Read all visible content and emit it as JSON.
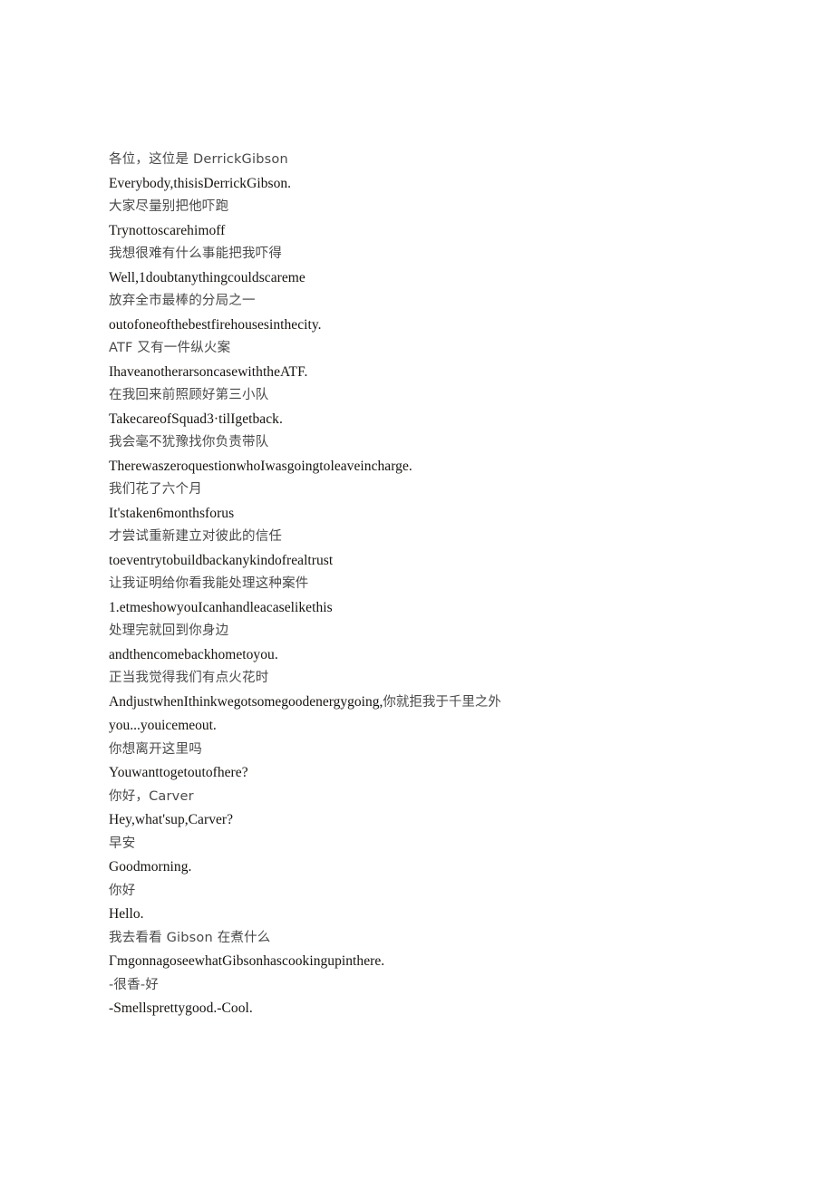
{
  "page": {
    "background_color": "#ffffff",
    "text_color_chinese": "#4a4a4a",
    "text_color_english": "#16120f"
  },
  "transcript": {
    "lines": [
      {
        "lang": "zh",
        "text": "各位，这位是 DerrickGibson"
      },
      {
        "lang": "en",
        "text": "Everybody,thisisDerrickGibson."
      },
      {
        "lang": "zh",
        "text": "大家尽量别把他吓跑"
      },
      {
        "lang": "en",
        "text": "Trynottoscarehimoff"
      },
      {
        "lang": "zh",
        "text": "我想很难有什么事能把我吓得"
      },
      {
        "lang": "en",
        "text": "Well,1doubtanythingcouldscareme"
      },
      {
        "lang": "zh",
        "text": "放弃全市最棒的分局之一"
      },
      {
        "lang": "en",
        "text": "outofoneofthebestfirehousesinthecity."
      },
      {
        "lang": "zh",
        "text": "ATF 又有一件纵火案"
      },
      {
        "lang": "en",
        "text": "IhaveanotherarsoncasewiththeATF."
      },
      {
        "lang": "zh",
        "text": "在我回来前照顾好第三小队"
      },
      {
        "lang": "en",
        "text": "TakecareofSquad3·tilIgetback."
      },
      {
        "lang": "zh",
        "text": "我会毫不犹豫找你负责带队"
      },
      {
        "lang": "en",
        "text": "TherewaszeroquestionwhoIwasgoingtoleaveincharge."
      },
      {
        "lang": "zh",
        "text": "我们花了六个月"
      },
      {
        "lang": "en",
        "text": "It'staken6monthsforus"
      },
      {
        "lang": "zh",
        "text": "才尝试重新建立对彼此的信任"
      },
      {
        "lang": "en",
        "text": "toeventrytobuildbackanykindofrealtrust"
      },
      {
        "lang": "zh",
        "text": "让我证明给你看我能处理这种案件"
      },
      {
        "lang": "en",
        "text": "1.etmeshowyouIcanhandleacaselikethis"
      },
      {
        "lang": "zh",
        "text": "处理完就回到你身边"
      },
      {
        "lang": "en",
        "text": "andthencomebackhometoyou."
      },
      {
        "lang": "zh",
        "text": "正当我觉得我们有点火花时"
      },
      {
        "lang": "mixed",
        "text_en_a": "AndjustwhenIthinkwegotsomegoodenergygoing,",
        "text_zh": "你就拒我于千里之外",
        "text_en_b": "you...youicemeout."
      },
      {
        "lang": "zh",
        "text": "你想离开这里吗"
      },
      {
        "lang": "en",
        "text": "Youwanttogetoutofhere?"
      },
      {
        "lang": "zh",
        "text": "你好，Carver"
      },
      {
        "lang": "en",
        "text": "Hey,what'sup,Carver?"
      },
      {
        "lang": "zh",
        "text": "早安"
      },
      {
        "lang": "en",
        "text": "Goodmorning."
      },
      {
        "lang": "zh",
        "text": "你好"
      },
      {
        "lang": "en",
        "text": "Hello."
      },
      {
        "lang": "zh",
        "text": "我去看看 Gibson 在煮什么"
      },
      {
        "lang": "en",
        "text": "ΓmgonnagoseewhatGibsonhascookingupinthere."
      },
      {
        "lang": "zh",
        "text": "-很香-好"
      },
      {
        "lang": "en",
        "text": "-Smellsprettygood.-Cool."
      }
    ]
  }
}
